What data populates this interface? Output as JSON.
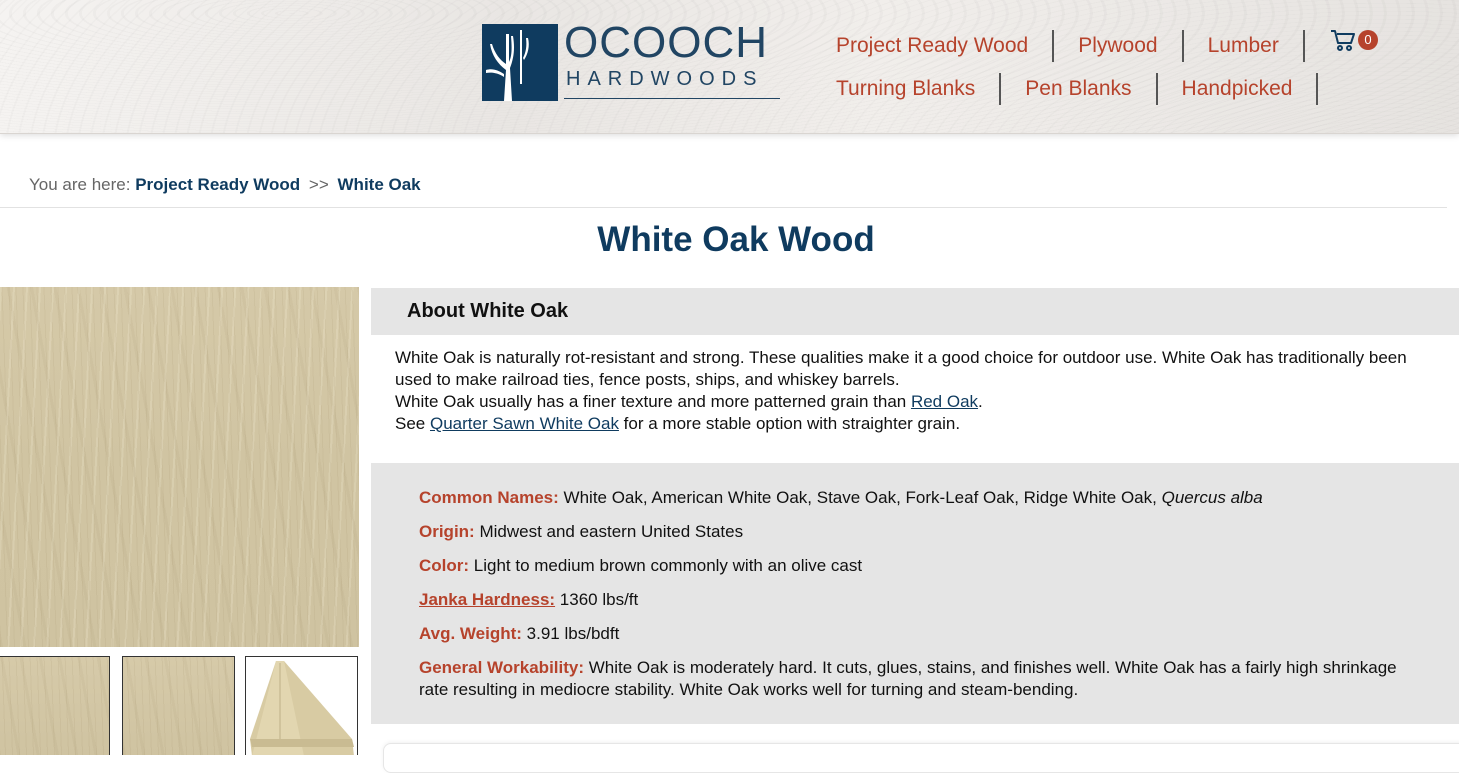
{
  "brand": {
    "name_top": "OCOOCH",
    "name_bottom": "HARDWOODS",
    "colors": {
      "navy": "#0f3b5f",
      "accent": "#b6432c",
      "panel": "#e5e5e5"
    }
  },
  "nav": {
    "row1": [
      "Project Ready Wood",
      "Plywood",
      "Lumber"
    ],
    "row2": [
      "Turning Blanks",
      "Pen Blanks",
      "Handpicked"
    ],
    "cart": {
      "icon": "cart-icon",
      "count": "0"
    }
  },
  "breadcrumb": {
    "prefix": "You are here:",
    "parent": "Project Ready Wood",
    "separator": ">>",
    "current": "White Oak"
  },
  "page": {
    "title": "White Oak Wood"
  },
  "about": {
    "heading": "About White Oak",
    "p1": "White Oak is naturally rot-resistant and strong. These qualities make it a good choice for outdoor use. White Oak has traditionally been used to make railroad ties, fence posts, ships, and whiskey barrels.",
    "p2_before": "White Oak usually has a finer texture and more patterned grain than ",
    "p2_link": "Red Oak",
    "p2_after": ".",
    "p3_before": "See ",
    "p3_link": "Quarter Sawn White Oak",
    "p3_after": " for a more stable option with straighter grain."
  },
  "specs": {
    "common_names_label": "Common Names:",
    "common_names_value": " White Oak, American White Oak, Stave Oak, Fork-Leaf Oak, Ridge White Oak, ",
    "common_names_latin": "Quercus alba",
    "origin_label": "Origin:",
    "origin_value": " Midwest and eastern United States",
    "color_label": "Color:",
    "color_value": " Light to medium brown commonly with an olive cast",
    "janka_label": "Janka Hardness:",
    "janka_value": " 1360 lbs/ft",
    "weight_label": "Avg. Weight:",
    "weight_value": " 3.91 lbs/bdft",
    "workability_label": "General Workability:",
    "workability_value": " White Oak is moderately hard. It cuts, glues, stains, and finishes well. White Oak has a fairly high shrinkage rate resulting in mediocre stability. White Oak works well for turning and steam-bending."
  }
}
